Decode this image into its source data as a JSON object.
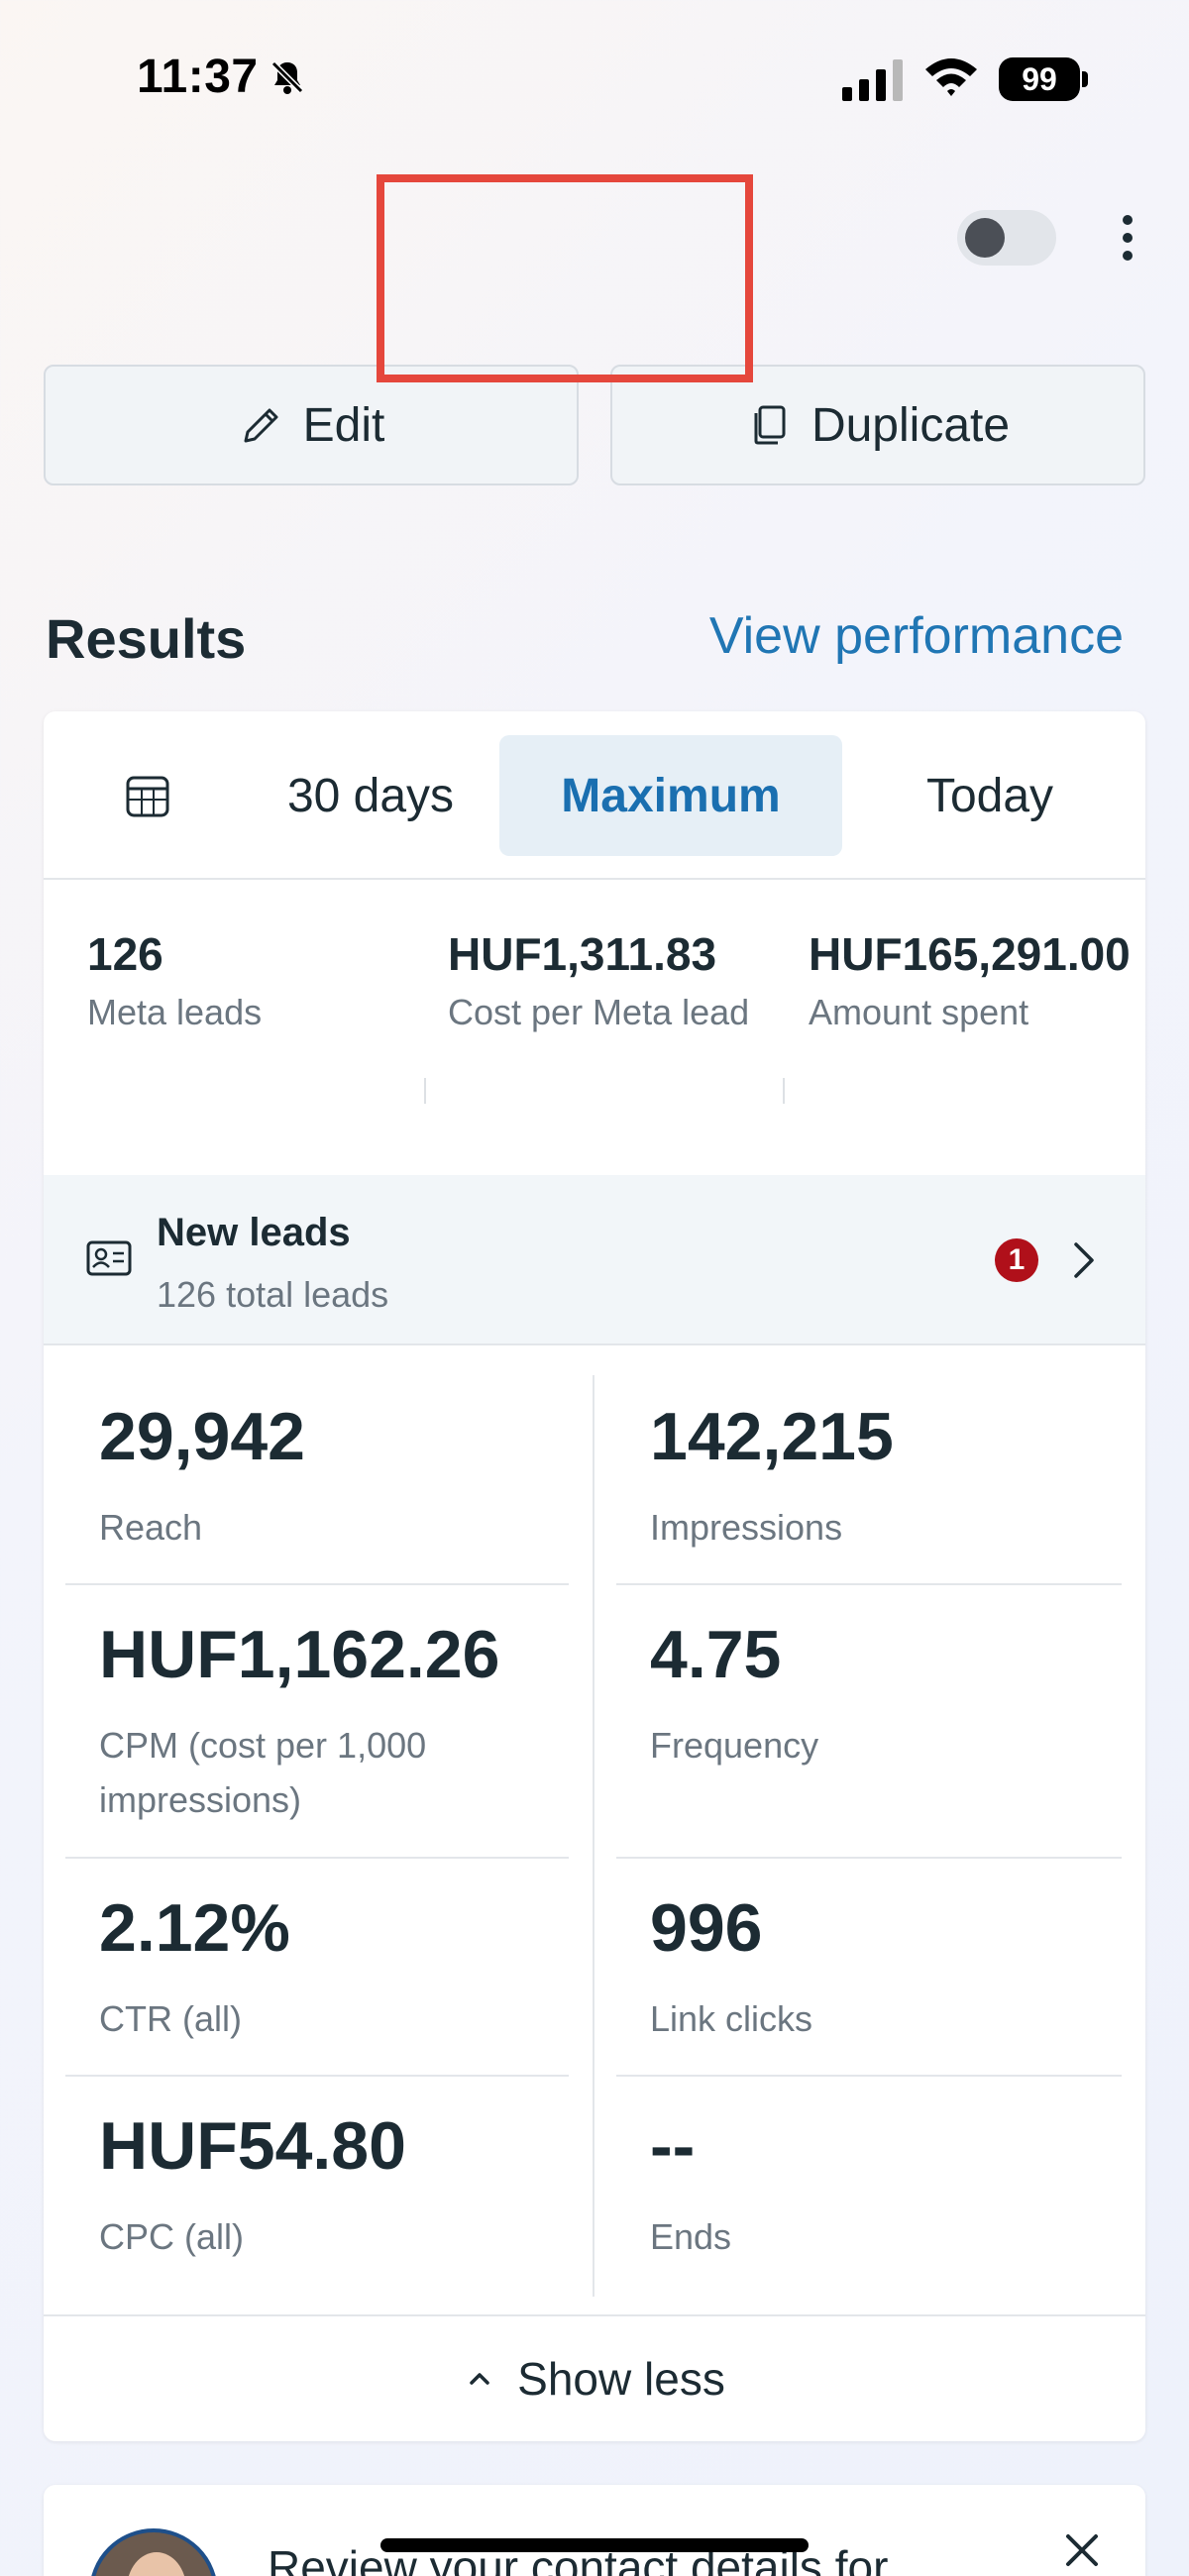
{
  "status_bar": {
    "time": "11:37",
    "battery": "99"
  },
  "actions": {
    "edit_label": "Edit",
    "duplicate_label": "Duplicate"
  },
  "results": {
    "title": "Results",
    "view_performance": "View performance",
    "tabs": [
      {
        "label": "30 days"
      },
      {
        "label": "Maximum",
        "selected": true
      },
      {
        "label": "Today"
      }
    ],
    "summary": [
      {
        "value": "126",
        "label": "Meta leads"
      },
      {
        "value": "HUF1,311.83",
        "label": "Cost per Meta lead"
      },
      {
        "value": "HUF165,291.00",
        "label": "Amount spent"
      }
    ],
    "leads": {
      "title": "New leads",
      "subtitle": "126 total leads",
      "badge": "1"
    },
    "metrics": [
      {
        "value": "29,942",
        "label": "Reach"
      },
      {
        "value": "142,215",
        "label": "Impressions"
      },
      {
        "value": "HUF1,162.26",
        "label": "CPM (cost per 1,000 impressions)"
      },
      {
        "value": "4.75",
        "label": "Frequency"
      },
      {
        "value": "2.12%",
        "label": "CTR (all)"
      },
      {
        "value": "996",
        "label": "Link clicks"
      },
      {
        "value": "HUF54.80",
        "label": "CPC (all)"
      },
      {
        "value": "--",
        "label": "Ends"
      }
    ],
    "show_less": "Show less"
  },
  "bottom_card": {
    "text": "Review your contact details for"
  },
  "colors": {
    "accent": "#2076b4",
    "highlight": "#e5473c",
    "badge": "#b0101a"
  }
}
